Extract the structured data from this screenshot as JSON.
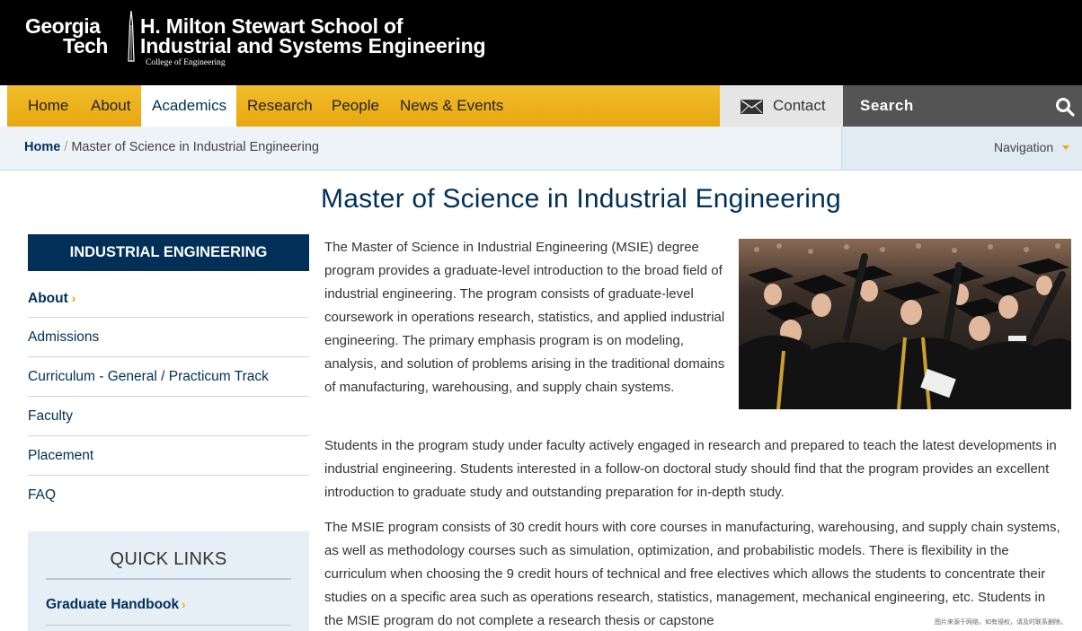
{
  "header": {
    "logo_gt_line1": "Georgia",
    "logo_gt_line2": "Tech",
    "school_line1": "H. Milton Stewart School of",
    "school_line2": "Industrial and Systems Engineering",
    "college": "College of Engineering"
  },
  "nav": {
    "items": [
      {
        "label": "Home"
      },
      {
        "label": "About"
      },
      {
        "label": "Academics"
      },
      {
        "label": "Research"
      },
      {
        "label": "People"
      },
      {
        "label": "News & Events"
      }
    ],
    "active": "Academics",
    "contact_label": "Contact",
    "search_label": "Search"
  },
  "breadcrumb": {
    "home": "Home",
    "separator": "/",
    "current": "Master of Science in Industrial Engineering",
    "navigation_label": "Navigation"
  },
  "page": {
    "title": "Master of Science in Industrial Engineering",
    "paragraphs": [
      "The Master of Science in Industrial Engineering (MSIE) degree program provides a graduate-level introduction to the broad field of industrial engineering. The program consists of graduate-level coursework in operations research, statistics, and applied industrial engineering. The primary emphasis program is on modeling, analysis, and solution of problems arising in the traditional domains of manufacturing, warehousing, and supply chain systems.",
      "Students in the program study under faculty actively engaged in research and prepared to teach the latest developments in industrial engineering. Students interested in a follow-on doctoral study should find that the program provides an excellent introduction to graduate study and outstanding preparation for in-depth study.",
      "The MSIE program consists of 30 credit hours with core courses in manufacturing, warehousing, and supply chain systems, as well as methodology courses such as simulation, optimization, and probabilistic models. There is flexibility in the curriculum when choosing the 9 credit hours of technical and free electives which allows the students to concentrate their studies on a specific area such as operations research, statistics, management, mechanical engineering, etc. Students in the MSIE program do not complete a research thesis or capstone"
    ],
    "photo_alt": "graduates-celebrating-photo"
  },
  "sidebar": {
    "heading": "INDUSTRIAL ENGINEERING",
    "items": [
      {
        "label": "About"
      },
      {
        "label": "Admissions"
      },
      {
        "label": "Curriculum - General / Practicum Track"
      },
      {
        "label": "Faculty"
      },
      {
        "label": "Placement"
      },
      {
        "label": "FAQ"
      }
    ],
    "arrow": "›"
  },
  "quick_links": {
    "title": "QUICK LINKS",
    "items": [
      {
        "label": "Graduate Handbook"
      }
    ]
  },
  "watermark": "图片来源于网络，如有侵权，请及时联系删除。",
  "colors": {
    "navy": "#003057",
    "gold": "#EAAA00",
    "header_bg": "#000000",
    "search_bg": "#545454"
  }
}
